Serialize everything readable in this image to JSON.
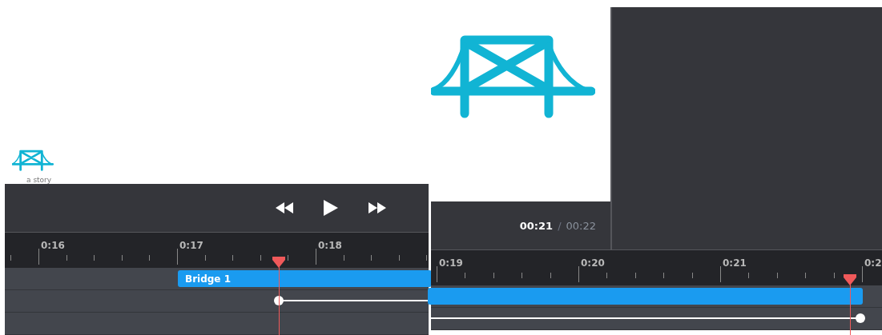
{
  "panels": [
    {
      "kind": "editor",
      "logo": {
        "tagline": "a story"
      },
      "transport": [
        {
          "kind": "rewind"
        },
        {
          "kind": "play"
        },
        {
          "kind": "fast-forward"
        }
      ],
      "ruler": {
        "labels": [
          "0:16",
          "0:17",
          "0:18"
        ]
      },
      "playhead": {
        "level": 0.647
      },
      "tracks": [
        {
          "kind": "clip",
          "label": "Bridge 1"
        },
        {
          "kind": "keyframe"
        },
        {
          "kind": "empty"
        }
      ]
    },
    {
      "kind": "preview",
      "time": {
        "current": "00:21",
        "separator": "/",
        "total": "00:22"
      },
      "ruler": {
        "labels": [
          "0:19",
          "0:20",
          "0:21",
          "0:2"
        ]
      },
      "playhead": {
        "level": 0.929
      },
      "tracks": [
        {
          "kind": "clip"
        },
        {
          "kind": "keyframe"
        }
      ]
    }
  ]
}
